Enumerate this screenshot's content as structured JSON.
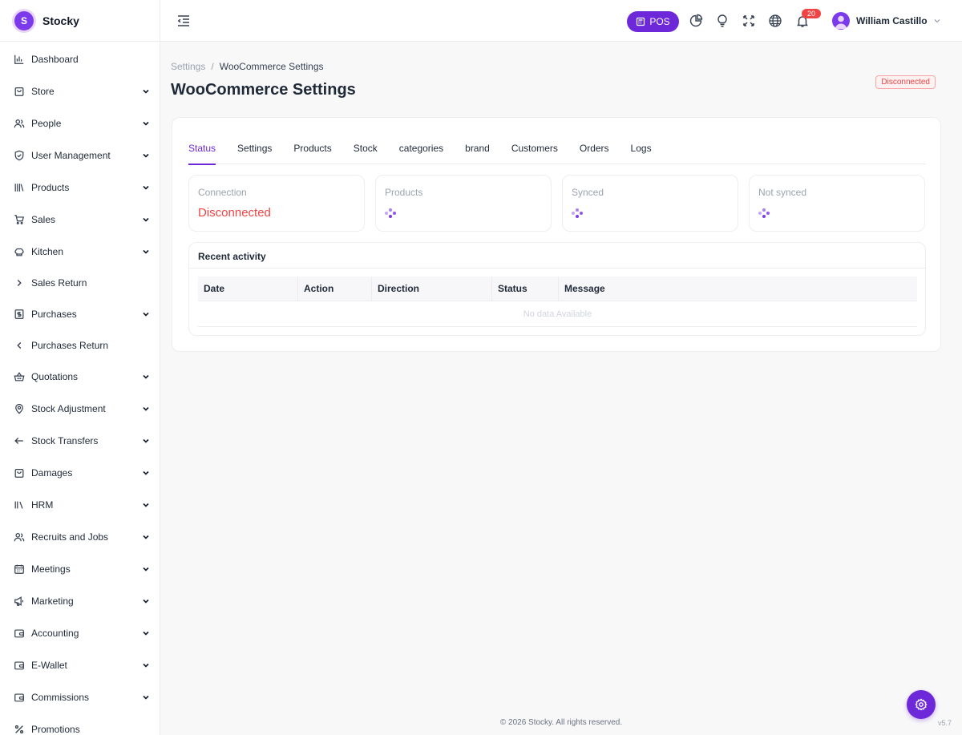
{
  "app": {
    "name": "Stocky",
    "logo_letter": "S"
  },
  "sidebar": {
    "items": [
      {
        "label": "Dashboard",
        "icon": "bar-chart-icon",
        "chevron": "none"
      },
      {
        "label": "Store",
        "icon": "store-bag-icon",
        "chevron": "down"
      },
      {
        "label": "People",
        "icon": "users-icon",
        "chevron": "down"
      },
      {
        "label": "User Management",
        "icon": "shield-check-icon",
        "chevron": "down"
      },
      {
        "label": "Products",
        "icon": "books-icon",
        "chevron": "down"
      },
      {
        "label": "Sales",
        "icon": "cart-icon",
        "chevron": "down"
      },
      {
        "label": "Kitchen",
        "icon": "chef-hat-icon",
        "chevron": "down"
      },
      {
        "label": "Sales Return",
        "icon": "chevron-right-icon",
        "chevron": "none"
      },
      {
        "label": "Purchases",
        "icon": "receipt-icon",
        "chevron": "down"
      },
      {
        "label": "Purchases Return",
        "icon": "chevron-left-icon",
        "chevron": "none"
      },
      {
        "label": "Quotations",
        "icon": "basket-icon",
        "chevron": "down"
      },
      {
        "label": "Stock Adjustment",
        "icon": "map-pin-icon",
        "chevron": "down"
      },
      {
        "label": "Stock Transfers",
        "icon": "arrow-left-icon",
        "chevron": "down"
      },
      {
        "label": "Damages",
        "icon": "box-icon",
        "chevron": "down"
      },
      {
        "label": "HRM",
        "icon": "library-icon",
        "chevron": "down"
      },
      {
        "label": "Recruits and Jobs",
        "icon": "users-icon",
        "chevron": "down"
      },
      {
        "label": "Meetings",
        "icon": "calendar-icon",
        "chevron": "down"
      },
      {
        "label": "Marketing",
        "icon": "megaphone-icon",
        "chevron": "down"
      },
      {
        "label": "Accounting",
        "icon": "wallet-icon",
        "chevron": "down"
      },
      {
        "label": "E-Wallet",
        "icon": "wallet-icon",
        "chevron": "down"
      },
      {
        "label": "Commissions",
        "icon": "wallet-icon",
        "chevron": "down"
      },
      {
        "label": "Promotions",
        "icon": "percent-icon",
        "chevron": "none"
      }
    ]
  },
  "topbar": {
    "pos_label": "POS",
    "notifications_count": "20",
    "user_name": "William Castillo"
  },
  "breadcrumb": {
    "parent": "Settings",
    "separator": "/",
    "current": "WooCommerce Settings"
  },
  "page": {
    "title": "WooCommerce Settings",
    "status_badge": "Disconnected"
  },
  "tabs": [
    "Status",
    "Settings",
    "Products",
    "Stock",
    "categories",
    "brand",
    "Customers",
    "Orders",
    "Logs"
  ],
  "active_tab": "Status",
  "stats": [
    {
      "label": "Connection",
      "value": "Disconnected"
    },
    {
      "label": "Products",
      "value": null
    },
    {
      "label": "Synced",
      "value": null
    },
    {
      "label": "Not synced",
      "value": null
    }
  ],
  "activity": {
    "title": "Recent activity",
    "columns": [
      "Date",
      "Action",
      "Direction",
      "Status",
      "Message"
    ],
    "empty_text": "No data Available"
  },
  "footer": {
    "copyright": "© 2026 Stocky. All rights reserved.",
    "version": "v5.7"
  },
  "colors": {
    "accent": "#6d28d9",
    "danger": "#ef4444"
  }
}
